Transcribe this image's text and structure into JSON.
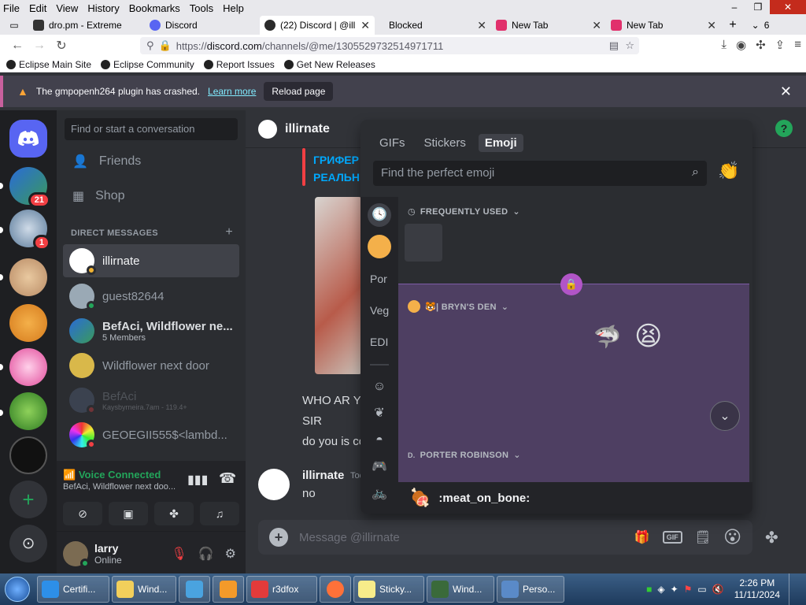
{
  "browser": {
    "menu": [
      "File",
      "Edit",
      "View",
      "History",
      "Bookmarks",
      "Tools",
      "Help"
    ],
    "tabs": [
      {
        "title": "dro.pm - Extreme",
        "color": "#333"
      },
      {
        "title": "Discord",
        "color": "#5865f2"
      },
      {
        "title": "(22) Discord | @ill",
        "color": "#2b2b2b"
      },
      {
        "title": "Blocked",
        "color": "#ffffff"
      },
      {
        "title": "New Tab",
        "color": "#e1306c"
      },
      {
        "title": "New Tab",
        "color": "#e1306c"
      }
    ],
    "tab_count": "6",
    "url_prefix": "https://",
    "url_host": "discord.com",
    "url_path": "/channels/@me/1305529732514971711",
    "bookmarks": [
      "Eclipse Main Site",
      "Eclipse Community",
      "Report Issues",
      "Get New Releases"
    ],
    "notification": {
      "message": "The gmpopenh264 plugin has crashed.",
      "link": "Learn more",
      "button": "Reload page"
    }
  },
  "discord": {
    "guild_badges": {
      "badge1": "21",
      "badge2": "1"
    },
    "search_placeholder": "Find or start a conversation",
    "nav": {
      "friends": "Friends",
      "shop": "Shop"
    },
    "dm_header": "DIRECT MESSAGES",
    "dms": [
      {
        "name": "illirnate",
        "sub": "",
        "status": "#f0b232"
      },
      {
        "name": "guest82644",
        "sub": "",
        "status": "#23a55a"
      },
      {
        "name": "BefAci, Wildflower ne...",
        "sub": "5 Members",
        "status": ""
      },
      {
        "name": "Wildflower next door",
        "sub": "",
        "status": ""
      },
      {
        "name": "BefAci",
        "sub": "Kaysbyrneira.7am - 119.4+",
        "status": "#f23f43"
      },
      {
        "name": "GEOEGII555$<lambd...",
        "sub": "",
        "status": "#f23f43"
      }
    ],
    "voice": {
      "status": "Voice Connected",
      "channel": "BefAci, Wildflower next doo..."
    },
    "user": {
      "name": "larry",
      "status": "Online"
    },
    "channel_name": "illirnate",
    "embed_title_lines": [
      "ГРИФЕР",
      "РЕАЛЬН"
    ],
    "messages": [
      "WHO AR YO",
      "SIR",
      "do you is co"
    ],
    "last_author": "illirnate",
    "last_time": "Tod",
    "last_message": "no",
    "composer_placeholder": "Message @illirnate",
    "composer_gif": "GIF"
  },
  "emoji_picker": {
    "tabs": [
      "GIFs",
      "Stickers",
      "Emoji"
    ],
    "active_tab": "Emoji",
    "search_placeholder": "Find the perfect emoji",
    "rail_labels": [
      "Por",
      "Veg",
      "EDI"
    ],
    "categories": {
      "frequent": "FREQUENTLY USED",
      "server": "🐯| BRYN'S DEN",
      "porter": "PORTER ROBINSON"
    },
    "footer_emoji_name": ":meat_on_bone:"
  },
  "taskbar": {
    "buttons": [
      "Certifi...",
      "Wind...",
      "",
      "",
      "r3dfox",
      "",
      "Sticky...",
      "Wind...",
      "Perso..."
    ],
    "time": "2:26 PM",
    "date": "11/11/2024"
  }
}
